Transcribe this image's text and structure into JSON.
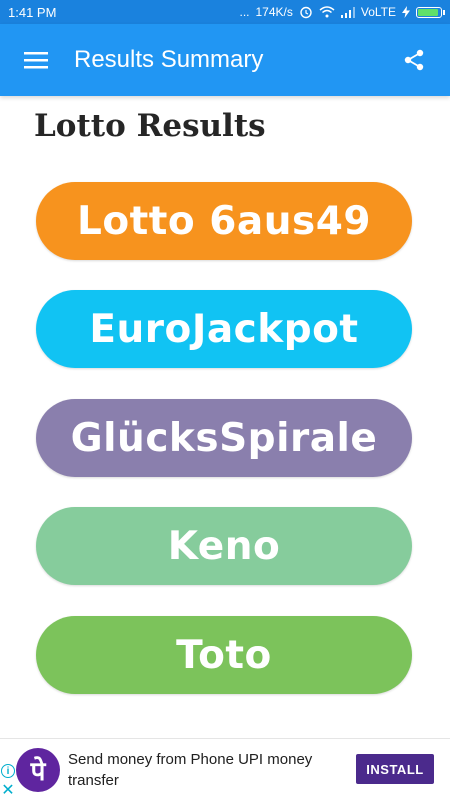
{
  "status_bar": {
    "time": "1:41 PM",
    "dots": "...",
    "speed": "174K/s",
    "network": "VoLTE"
  },
  "app_bar": {
    "title": "Results Summary",
    "menu_icon": "hamburger-menu-icon",
    "share_icon": "share-icon",
    "color": "#2196f3"
  },
  "page": {
    "heading": "Lotto Results"
  },
  "games": [
    {
      "label": "Lotto 6aus49",
      "color": "#f7931e"
    },
    {
      "label": "EuroJackpot",
      "color": "#11c3f3"
    },
    {
      "label": "GlücksSpirale",
      "color": "#8a7fad"
    },
    {
      "label": "Keno",
      "color": "#86cc9c"
    },
    {
      "label": "Toto",
      "color": "#7cc35b"
    }
  ],
  "ad": {
    "logo_glyph": "पे",
    "text": "Send money from Phone UPI money transfer",
    "install_label": "INSTALL",
    "info_glyph": "i",
    "close_glyph": "✕"
  }
}
